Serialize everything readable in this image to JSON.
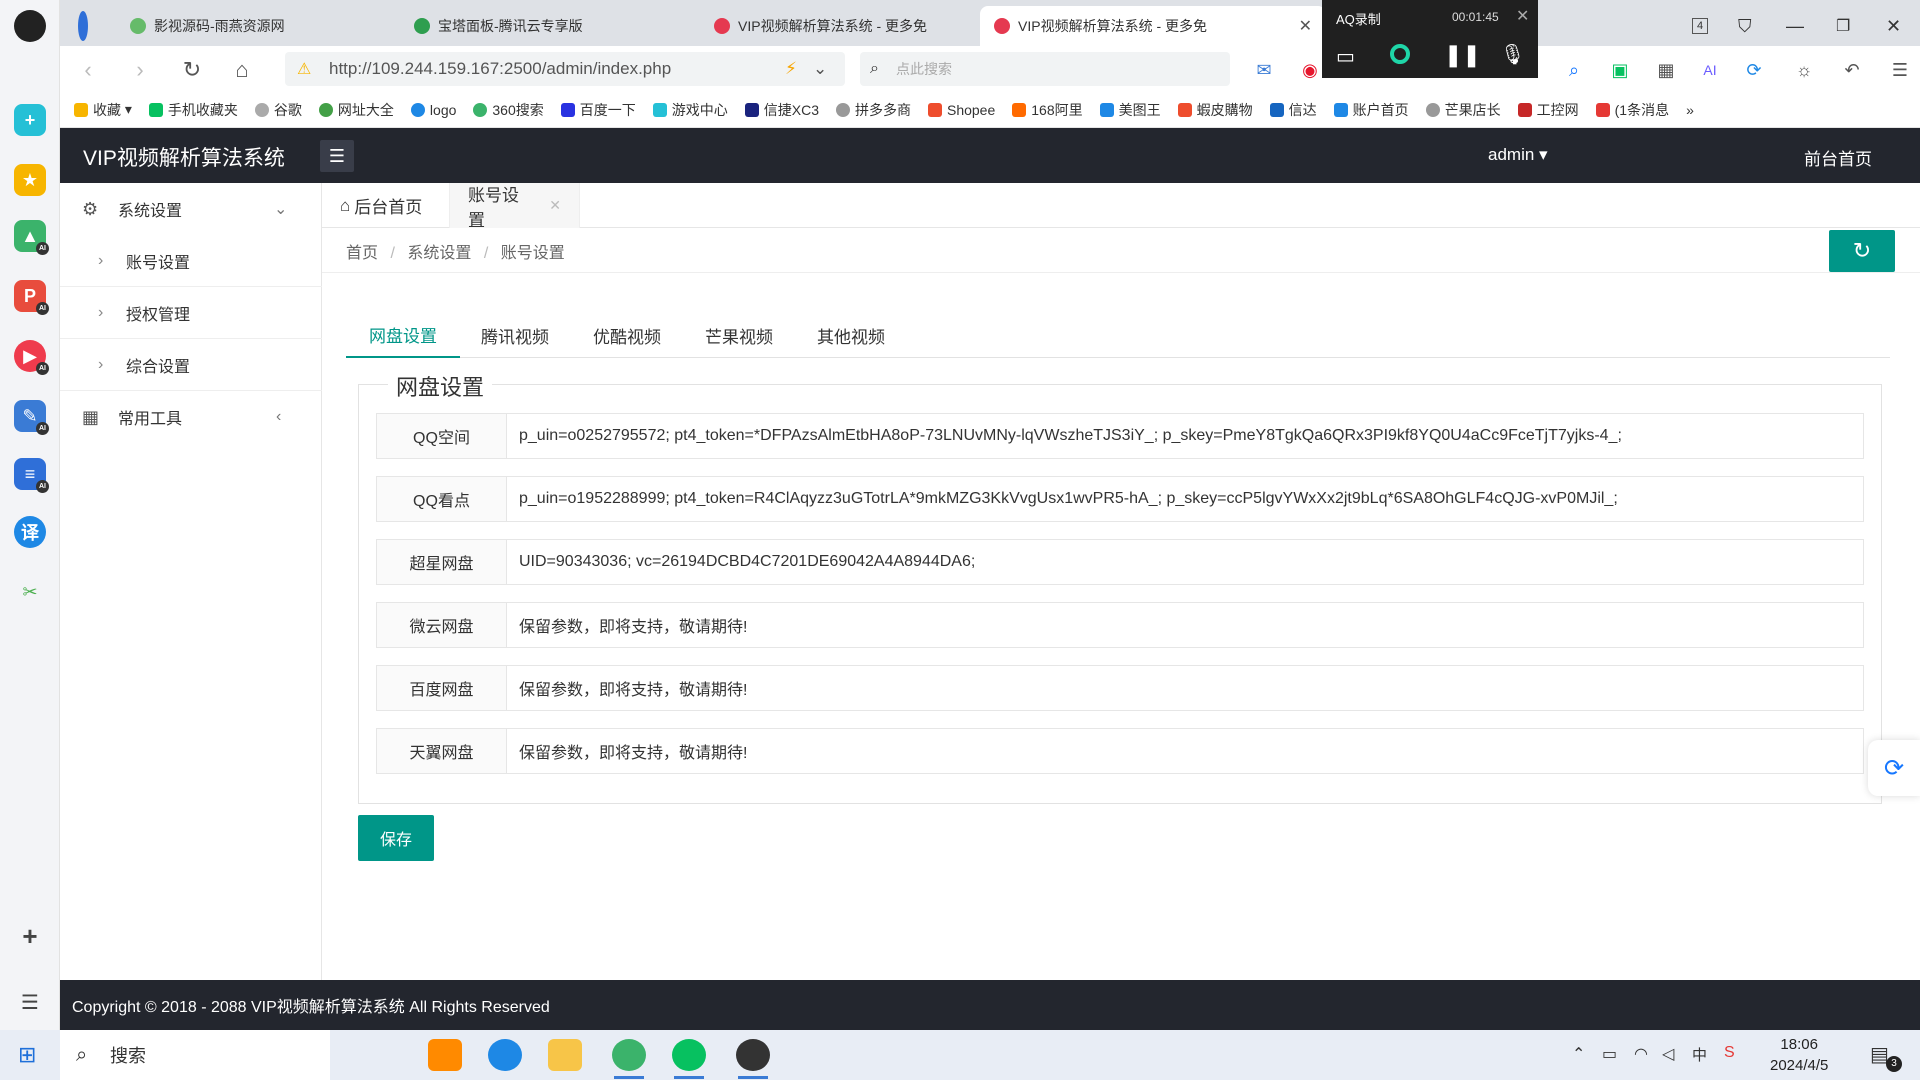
{
  "browser": {
    "tabs": [
      {
        "title": "影视源码-雨燕资源网"
      },
      {
        "title": "宝塔面板-腾讯云专享版"
      },
      {
        "title": "VIP视频解析算法系统 - 更多免"
      },
      {
        "title": "VIP视频解析算法系统 - 更多免"
      }
    ],
    "tab_count": "4",
    "url": "http://109.244.159.167:2500/admin/index.php",
    "search_placeholder": "点此搜索",
    "bookmarks": [
      "收藏",
      "手机收藏夹",
      "谷歌",
      "网址大全",
      "logo",
      "360搜索",
      "百度一下",
      "游戏中心",
      "信捷XC3",
      "拼多多商",
      "Shopee",
      "168阿里",
      "美图王",
      "蝦皮購物",
      "信达",
      "账户首页",
      "芒果店长",
      "工控网",
      "(1条消息"
    ]
  },
  "recorder": {
    "title": "AQ录制",
    "time": "00:01:45"
  },
  "app": {
    "title": "VIP视频解析算法系统",
    "user": "admin",
    "front_link": "前台首页"
  },
  "sidebar": {
    "groups": [
      {
        "label": "系统设置",
        "icon": "gear-icon",
        "items": [
          "账号设置",
          "授权管理",
          "综合设置"
        ]
      },
      {
        "label": "常用工具",
        "icon": "grid-icon",
        "items": []
      }
    ]
  },
  "page_tabs": [
    {
      "label": "后台首页",
      "icon": "home-icon"
    },
    {
      "label": "账号设置"
    }
  ],
  "breadcrumb": [
    "首页",
    "系统设置",
    "账号设置"
  ],
  "content_tabs": [
    "网盘设置",
    "腾讯视频",
    "优酷视频",
    "芒果视频",
    "其他视频"
  ],
  "form": {
    "legend": "网盘设置",
    "fields": [
      {
        "label": "QQ空间",
        "value": "p_uin=o0252795572; pt4_token=*DFPAzsAlmEtbHA8oP-73LNUvMNy-lqVWszheTJS3iY_; p_skey=PmeY8TgkQa6QRx3PI9kf8YQ0U4aCc9FceTjT7yjks-4_;"
      },
      {
        "label": "QQ看点",
        "value": "p_uin=o1952288999; pt4_token=R4ClAqyzz3uGTotrLA*9mkMZG3KkVvgUsx1wvPR5-hA_; p_skey=ccP5lgvYWxXx2jt9bLq*6SA8OhGLF4cQJG-xvP0MJil_;"
      },
      {
        "label": "超星网盘",
        "value": "UID=90343036; vc=26194DCBD4C7201DE69042A4A8944DA6;"
      },
      {
        "label": "微云网盘",
        "value": "保留参数，即将支持，敬请期待!"
      },
      {
        "label": "百度网盘",
        "value": "保留参数，即将支持，敬请期待!"
      },
      {
        "label": "天翼网盘",
        "value": "保留参数，即将支持，敬请期待!"
      }
    ],
    "save_label": "保存"
  },
  "footer": {
    "text": "Copyright © 2018 - 2088 VIP视频解析算法系统 All Rights Reserved"
  },
  "taskbar": {
    "search_label": "搜索",
    "time": "18:06",
    "date": "2024/4/5",
    "notif_count": "3"
  },
  "colors": {
    "accent": "#009688",
    "header_bg": "#23262e"
  }
}
